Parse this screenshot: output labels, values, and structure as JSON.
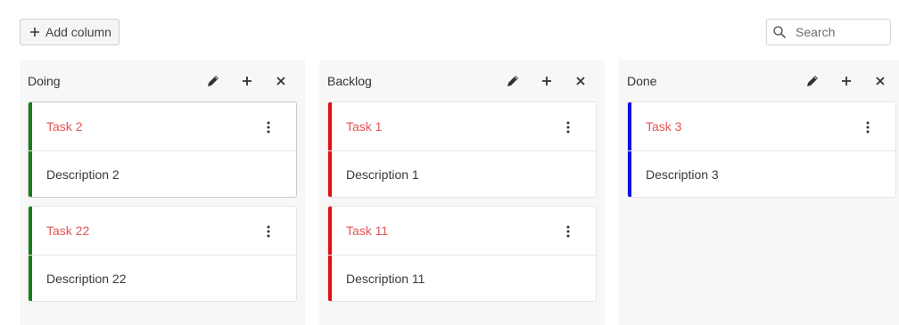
{
  "toolbar": {
    "add_column_label": "Add column",
    "add_icon": "plus-icon",
    "search_placeholder": "Search",
    "search_icon": "search-icon"
  },
  "colors": {
    "card_title": "#e25555",
    "bar_green": "#1a7f1a",
    "bar_red": "#e01010",
    "bar_blue": "#1010e0",
    "column_bg": "#f7f7f7"
  },
  "columns": [
    {
      "title": "Doing",
      "actions": [
        "pencil-icon",
        "plus-icon",
        "close-icon"
      ],
      "cards": [
        {
          "title": "Task 2",
          "description": "Description 2",
          "color": "#1a7f1a"
        },
        {
          "title": "Task 22",
          "description": "Description 22",
          "color": "#1a7f1a"
        }
      ]
    },
    {
      "title": "Backlog",
      "actions": [
        "pencil-icon",
        "plus-icon",
        "close-icon"
      ],
      "cards": [
        {
          "title": "Task 1",
          "description": "Description 1",
          "color": "#e01010"
        },
        {
          "title": "Task 11",
          "description": "Description 11",
          "color": "#e01010"
        }
      ]
    },
    {
      "title": "Done",
      "actions": [
        "pencil-icon",
        "plus-icon",
        "close-icon"
      ],
      "cards": [
        {
          "title": "Task 3",
          "description": "Description 3",
          "color": "#1010e0"
        }
      ]
    }
  ]
}
